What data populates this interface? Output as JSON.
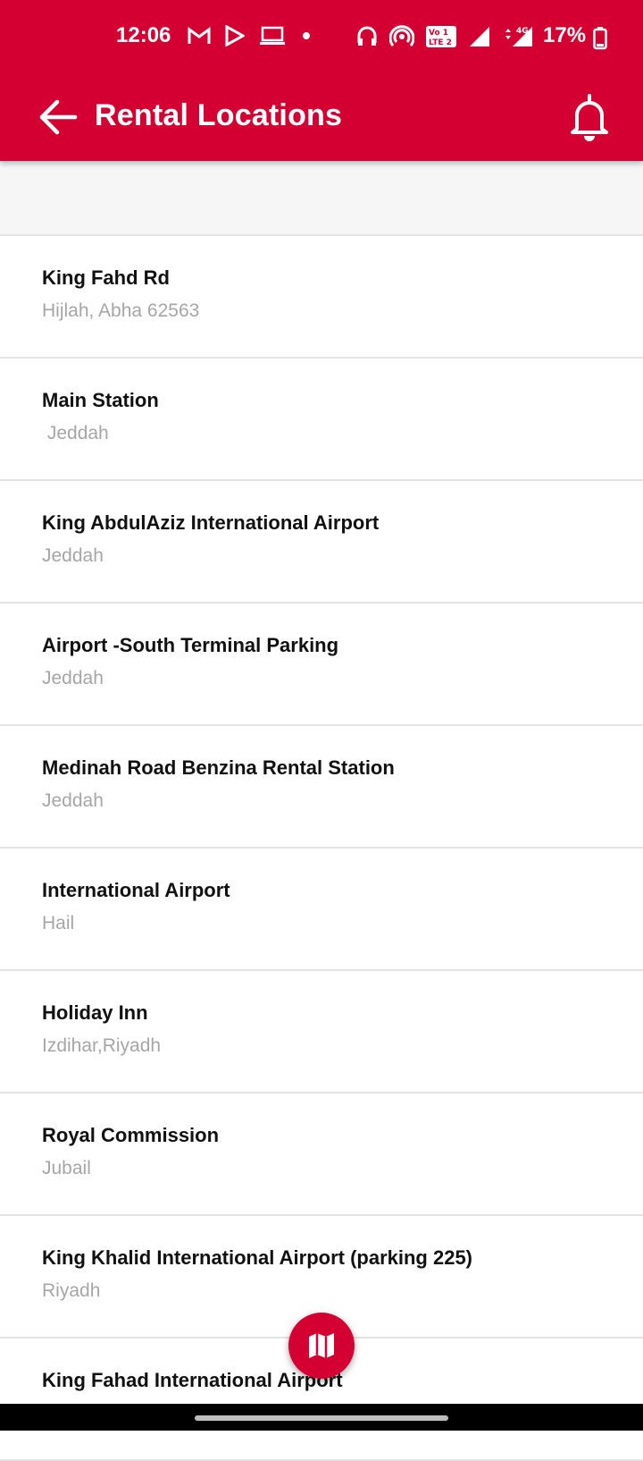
{
  "status_bar": {
    "time": "12:06",
    "battery": "17%",
    "left_icons": [
      "gmail-icon",
      "play-store-icon",
      "laptop-icon",
      "dot-icon"
    ],
    "right_icons": [
      "headphones-icon",
      "hotspot-icon",
      "volte-icon",
      "signal-icon",
      "signal-4g-icon"
    ]
  },
  "app_bar": {
    "title": "Rental Locations",
    "background": "#d50032"
  },
  "locations": [
    {
      "name": "King Fahd Rd",
      "area": "Hijlah, Abha 62563"
    },
    {
      "name": "Main Station",
      "area": " Jeddah"
    },
    {
      "name": "King AbdulAziz International Airport",
      "area": "Jeddah"
    },
    {
      "name": "Airport -South Terminal Parking",
      "area": "Jeddah"
    },
    {
      "name": "Medinah Road Benzina Rental Station",
      "area": "Jeddah"
    },
    {
      "name": "International Airport",
      "area": "Hail"
    },
    {
      "name": "Holiday Inn",
      "area": "Izdihar,Riyadh"
    },
    {
      "name": "Royal Commission",
      "area": "Jubail"
    },
    {
      "name": "King Khalid International Airport (parking 225)",
      "area": "Riyadh"
    },
    {
      "name": "King Fahad International Airport",
      "area": ""
    }
  ],
  "fab": {
    "icon": "map-icon"
  }
}
